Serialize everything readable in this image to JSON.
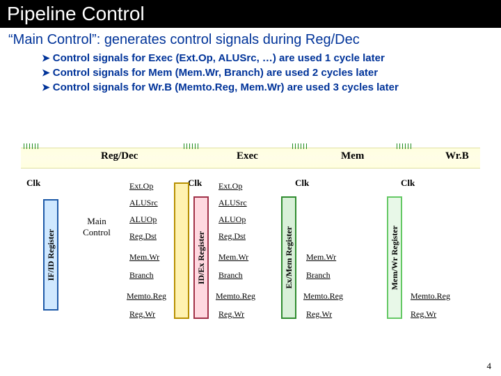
{
  "title": "Pipeline Control",
  "subtitle": "“Main Control”:  generates control signals during Reg/Dec",
  "bullets": [
    "Control signals for Exec (Ext.Op, ALUSrc, …) are used 1 cycle later",
    "Control signals for Mem (Mem.Wr, Branch) are used 2 cycles later",
    "Control signals for Wr.B (Memto.Reg, Mem.Wr) are used 3 cycles later"
  ],
  "stages": {
    "regdec": "Reg/Dec",
    "exec": "Exec",
    "mem": "Mem",
    "wrb": "Wr.B"
  },
  "clk_label": "Clk",
  "main_control": "Main Control",
  "registers": {
    "ifid": "IF/ID Register",
    "idex": "ID/Ex Register",
    "exmem": "Ex/Mem Register",
    "memwr": "Mem/Wr Register"
  },
  "signals": {
    "extop": "Ext.Op",
    "alusrc": "ALUSrc",
    "aluop": "ALUOp",
    "regdst": "Reg.Dst",
    "memwr": "Mem.Wr",
    "branch": "Branch",
    "memtoreg": "Memto.Reg",
    "regwr": "Reg.Wr"
  },
  "page_number": "4"
}
